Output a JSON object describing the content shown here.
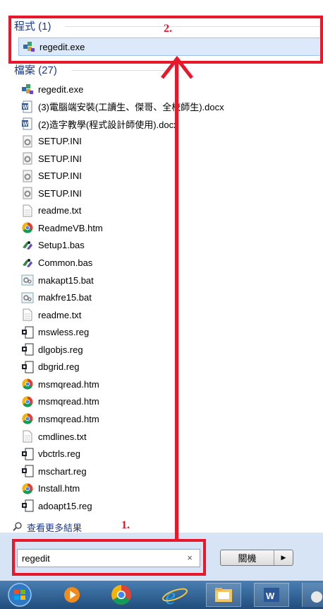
{
  "programs": {
    "heading": "程式 (1)",
    "items": [
      {
        "label": "regedit.exe",
        "icon": "regedit-icon"
      }
    ]
  },
  "files": {
    "heading": "檔案 (27)",
    "items": [
      {
        "label": "regedit.exe",
        "icon": "regedit-icon"
      },
      {
        "label": "(3)電腦端安裝(工讀生、傑哥、全校師生).docx",
        "icon": "word-doc-icon"
      },
      {
        "label": "(2)造字教學(程式設計師使用).docx",
        "icon": "word-doc-icon"
      },
      {
        "label": "SETUP.INI",
        "icon": "ini-file-icon"
      },
      {
        "label": "SETUP.INI",
        "icon": "ini-file-icon"
      },
      {
        "label": "SETUP.INI",
        "icon": "ini-file-icon"
      },
      {
        "label": "SETUP.INI",
        "icon": "ini-file-icon"
      },
      {
        "label": "readme.txt",
        "icon": "text-file-icon"
      },
      {
        "label": "ReadmeVB.htm",
        "icon": "chrome-html-icon"
      },
      {
        "label": "Setup1.bas",
        "icon": "vb-bas-icon"
      },
      {
        "label": "Common.bas",
        "icon": "vb-bas-icon"
      },
      {
        "label": "makapt15.bat",
        "icon": "bat-file-icon"
      },
      {
        "label": "makfre15.bat",
        "icon": "bat-file-icon"
      },
      {
        "label": "readme.txt",
        "icon": "text-file-icon"
      },
      {
        "label": "mswless.reg",
        "icon": "reg-file-icon"
      },
      {
        "label": "dlgobjs.reg",
        "icon": "reg-file-icon"
      },
      {
        "label": "dbgrid.reg",
        "icon": "reg-file-icon"
      },
      {
        "label": "msmqread.htm",
        "icon": "chrome-html-icon"
      },
      {
        "label": "msmqread.htm",
        "icon": "chrome-html-icon"
      },
      {
        "label": "msmqread.htm",
        "icon": "chrome-html-icon"
      },
      {
        "label": "cmdlines.txt",
        "icon": "text-file-icon"
      },
      {
        "label": "vbctrls.reg",
        "icon": "reg-file-icon"
      },
      {
        "label": "mschart.reg",
        "icon": "reg-file-icon"
      },
      {
        "label": "Install.htm",
        "icon": "chrome-html-icon"
      },
      {
        "label": "adoapt15.reg",
        "icon": "reg-file-icon"
      }
    ]
  },
  "see_more": "查看更多結果",
  "search": {
    "value": "regedit",
    "clear": "×"
  },
  "shutdown": {
    "label": "關機",
    "arrow": "▶"
  },
  "annotations": {
    "step1": "1.",
    "step2": "2."
  },
  "colors": {
    "annotation_red": "#e8182a",
    "heading_blue": "#1e3a8a",
    "selection": "#dbe9fb"
  }
}
